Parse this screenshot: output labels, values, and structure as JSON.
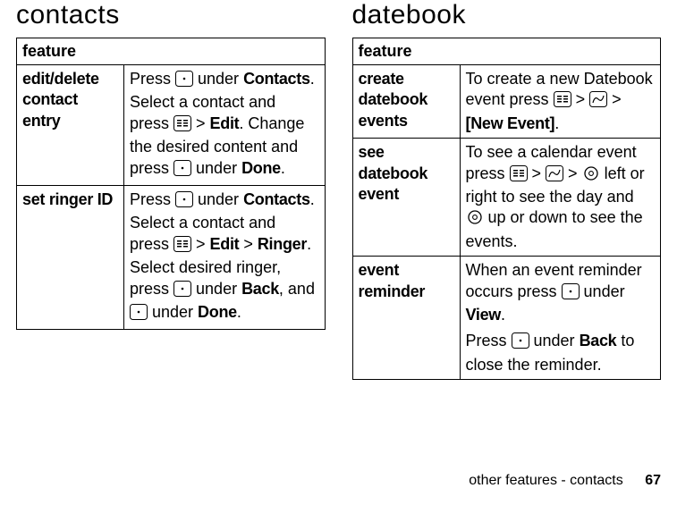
{
  "left": {
    "title": "contacts",
    "header": "feature",
    "rows": [
      {
        "name": "edit/delete contact entry",
        "d1": "Press ",
        "d2": " under ",
        "ui1": "Contacts",
        "d3": ". Select a contact and press ",
        "d4": " > ",
        "ui2": "Edit",
        "d5": ". Change the desired content and press ",
        "d6": " under ",
        "ui3": "Done",
        "d7": "."
      },
      {
        "name": "set ringer ID",
        "d1": "Press ",
        "d2": " under ",
        "ui1": "Contacts",
        "d3": ". Select a contact and press ",
        "d4": " > ",
        "ui2": "Edit",
        "d5": " > ",
        "ui3": "Ringer",
        "d6": ". Select desired ringer, press ",
        "d7": " under ",
        "ui4": "Back",
        "d8": ", and ",
        "d9": " under ",
        "ui5": "Done",
        "d10": "."
      }
    ]
  },
  "right": {
    "title": "datebook",
    "header": "feature",
    "rows": [
      {
        "name": "create datebook events",
        "d1": "To create a new Datebook event press ",
        "d2": " > ",
        "d3": " > ",
        "ui1": "[New Event]",
        "d4": "."
      },
      {
        "name": "see datebook event",
        "d1": "To see a calendar event press ",
        "d2": " > ",
        "d3": " > ",
        "d4": " left or right to see the day and ",
        "d5": " up or down to see the events."
      },
      {
        "name": "event reminder",
        "d1": "When an event reminder occurs press ",
        "d2": " under ",
        "ui1": "View",
        "d3": ".",
        "p2a": "Press ",
        "p2b": " under ",
        "ui2": "Back",
        "p2c": " to close the reminder."
      }
    ]
  },
  "footer": {
    "text": "other features - contacts",
    "page": "67"
  }
}
